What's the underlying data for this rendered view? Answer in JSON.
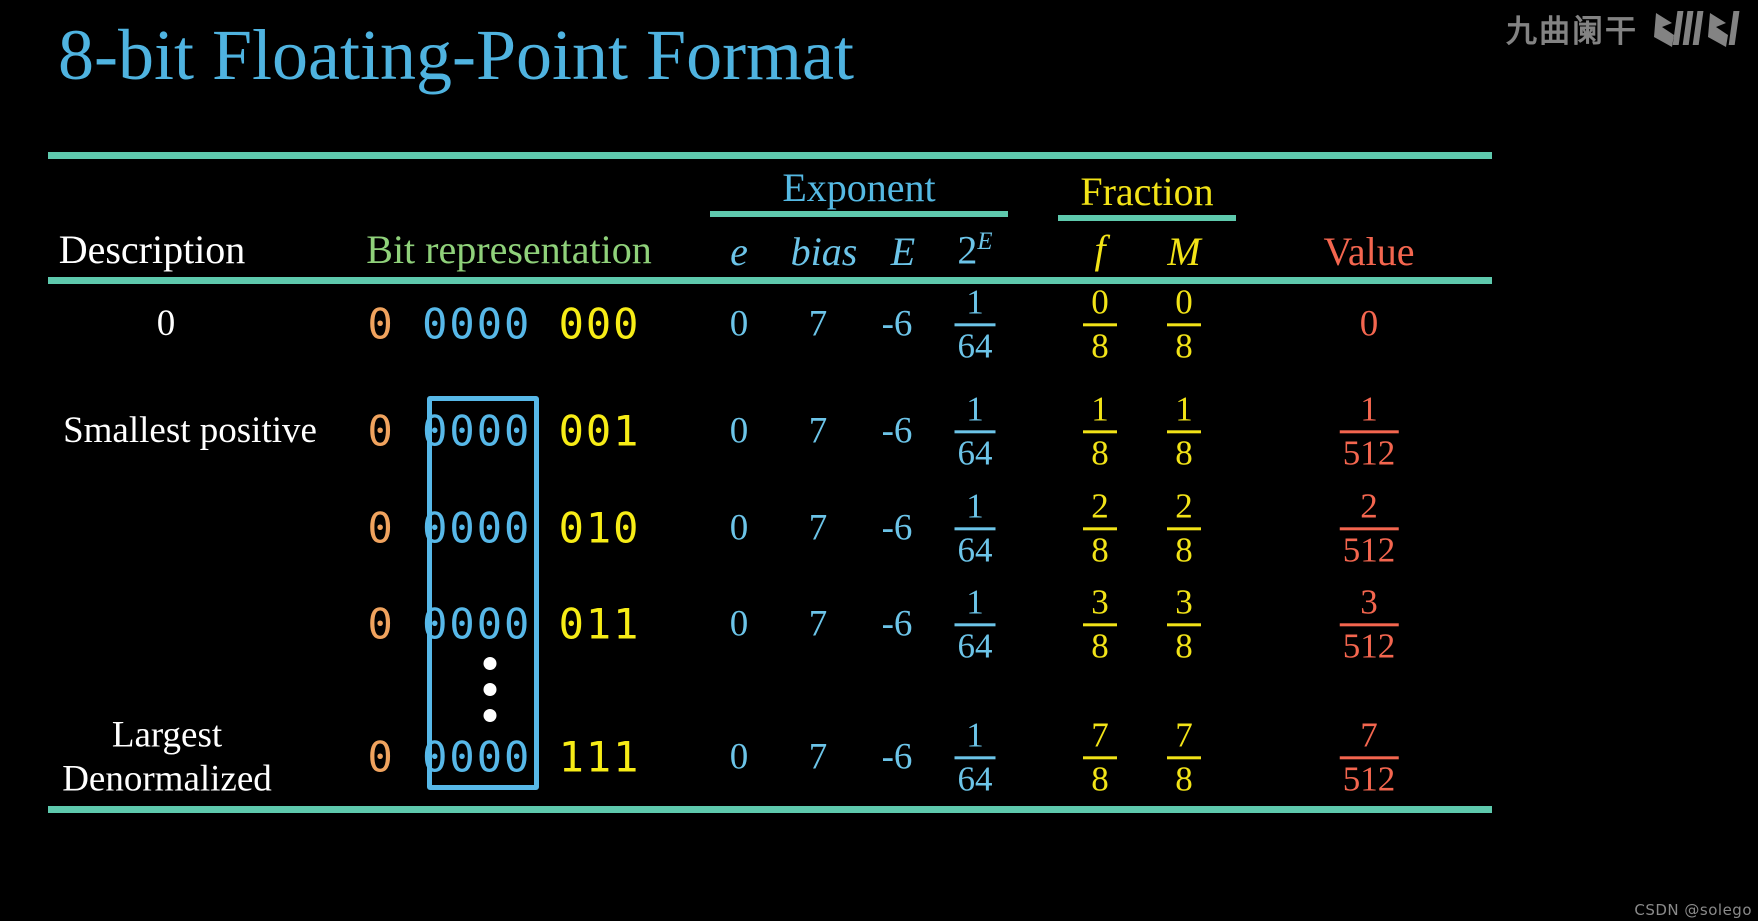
{
  "title": "8-bit Floating-Point Format",
  "watermarks": {
    "channel": "九曲阑干",
    "brand_icon": "bilibili-logo",
    "credit": "CSDN @solego"
  },
  "table": {
    "group_headers": {
      "exponent": "Exponent",
      "fraction": "Fraction"
    },
    "columns": {
      "description": "Description",
      "bit_representation": "Bit representation",
      "e": "e",
      "bias": "bias",
      "E": "E",
      "two_pow_E_base": "2",
      "two_pow_E_exp": "E",
      "f": "f",
      "M": "M",
      "value": "Value"
    },
    "ellipsis_icon": "vertical-dots-icon",
    "rows": [
      {
        "description": "0",
        "bits": {
          "sign": "0",
          "exponent": "0000",
          "fraction": "000"
        },
        "e": "0",
        "bias": "7",
        "E": "-6",
        "two_pow_E": {
          "numerator": "1",
          "denominator": "64"
        },
        "f": {
          "numerator": "0",
          "denominator": "8"
        },
        "M": {
          "numerator": "0",
          "denominator": "8"
        },
        "value": "0"
      },
      {
        "description": "Smallest positive",
        "bits": {
          "sign": "0",
          "exponent": "0000",
          "fraction": "001"
        },
        "e": "0",
        "bias": "7",
        "E": "-6",
        "two_pow_E": {
          "numerator": "1",
          "denominator": "64"
        },
        "f": {
          "numerator": "1",
          "denominator": "8"
        },
        "M": {
          "numerator": "1",
          "denominator": "8"
        },
        "value": {
          "numerator": "1",
          "denominator": "512"
        }
      },
      {
        "description": "",
        "bits": {
          "sign": "0",
          "exponent": "0000",
          "fraction": "010"
        },
        "e": "0",
        "bias": "7",
        "E": "-6",
        "two_pow_E": {
          "numerator": "1",
          "denominator": "64"
        },
        "f": {
          "numerator": "2",
          "denominator": "8"
        },
        "M": {
          "numerator": "2",
          "denominator": "8"
        },
        "value": {
          "numerator": "2",
          "denominator": "512"
        }
      },
      {
        "description": "",
        "bits": {
          "sign": "0",
          "exponent": "0000",
          "fraction": "011"
        },
        "e": "0",
        "bias": "7",
        "E": "-6",
        "two_pow_E": {
          "numerator": "1",
          "denominator": "64"
        },
        "f": {
          "numerator": "3",
          "denominator": "8"
        },
        "M": {
          "numerator": "3",
          "denominator": "8"
        },
        "value": {
          "numerator": "3",
          "denominator": "512"
        }
      },
      {
        "description_line1": "Largest",
        "description_line2": "Denormalized",
        "bits": {
          "sign": "0",
          "exponent": "0000",
          "fraction": "111"
        },
        "e": "0",
        "bias": "7",
        "E": "-6",
        "two_pow_E": {
          "numerator": "1",
          "denominator": "64"
        },
        "f": {
          "numerator": "7",
          "denominator": "8"
        },
        "M": {
          "numerator": "7",
          "denominator": "8"
        },
        "value": {
          "numerator": "7",
          "denominator": "512"
        }
      }
    ]
  },
  "colors": {
    "background": "#000000",
    "title": "#4fb3e0",
    "rule": "#5ec9ad",
    "sign_bit": "#f0a35e",
    "exponent_bit": "#57b8e8",
    "fraction_bit": "#f7ec16",
    "bit_rep_header": "#8fd17a",
    "value": "#f4664f",
    "description": "#ffffff"
  }
}
